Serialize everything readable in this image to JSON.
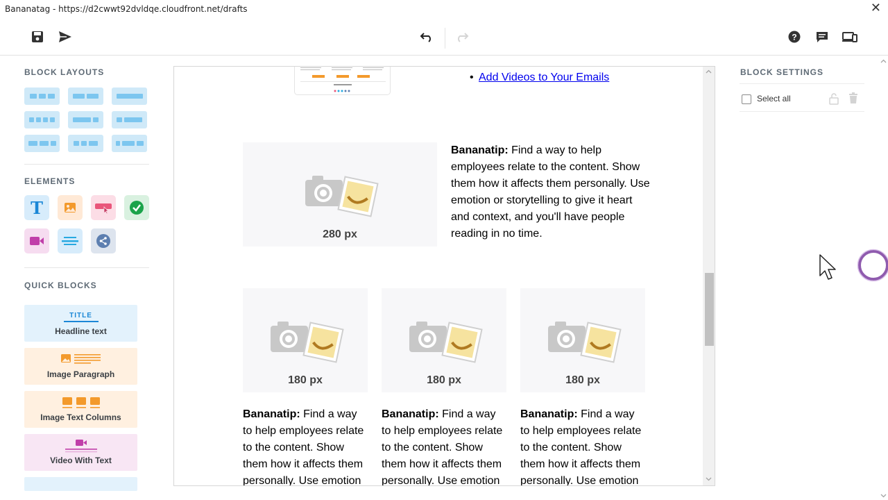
{
  "window": {
    "title": "Bananatag - https://d2cwwt92dvldqe.cloudfront.net/drafts",
    "close_glyph": "✕"
  },
  "toolbar": {
    "icons": [
      "save-icon",
      "send-icon",
      "undo-icon",
      "redo-icon",
      "help-icon",
      "comments-icon",
      "preview-devices-icon"
    ]
  },
  "sidebar": {
    "block_layouts_title": "BLOCK LAYOUTS",
    "elements_title": "ELEMENTS",
    "elements": [
      {
        "icon": "text-icon",
        "color": "#d7ecfb"
      },
      {
        "icon": "image-icon",
        "color": "#ffe9d6"
      },
      {
        "icon": "button-icon",
        "color": "#fcdde6"
      },
      {
        "icon": "checkmark-icon",
        "color": "#d9f1e0"
      },
      {
        "icon": "video-icon",
        "color": "#f6dcf0"
      },
      {
        "icon": "divider-icon",
        "color": "#d7ecfb"
      },
      {
        "icon": "social-share-icon",
        "color": "#dde4ee"
      }
    ],
    "quick_blocks_title": "QUICK BLOCKS",
    "quick_blocks": [
      {
        "label": "Headline text",
        "icon_text": "TITLE",
        "color": "#e3f2fc"
      },
      {
        "label": "Image Paragraph",
        "color": "#fff0e0"
      },
      {
        "label": "Image Text Columns",
        "color": "#fff0e0"
      },
      {
        "label": "Video With Text",
        "color": "#f8e6f4"
      }
    ]
  },
  "canvas": {
    "bullet": "•",
    "link_text": "Add Videos to Your Emails",
    "tip_bold": "Bananatip:",
    "tip_wide_text": " Find a way to help employees relate to the content. Show them how it affects them personally. Use emotion or storytelling to give it heart and context, and you'll have people reading in no time.",
    "placeholder_wide_label": "280 px",
    "columns": [
      {
        "label": "180 px",
        "tip_text": " Find a way to help employees relate to the content. Show them how it affects them personally. Use emotion"
      },
      {
        "label": "180 px",
        "tip_text": " Find a way to help employees relate to the content. Show them how it affects them personally. Use emotion"
      },
      {
        "label": "180 px",
        "tip_text": " Find a way to help employees relate to the content. Show them how it affects them personally. Use emotion"
      }
    ]
  },
  "block_settings": {
    "title": "BLOCK SETTINGS",
    "select_all_label": "Select all",
    "icons": [
      "lock-icon",
      "trash-icon"
    ]
  },
  "colors": {
    "accent_blue": "#7cc6ef",
    "link": "#0000ee",
    "cursor_ring": "#7b3ea0"
  }
}
